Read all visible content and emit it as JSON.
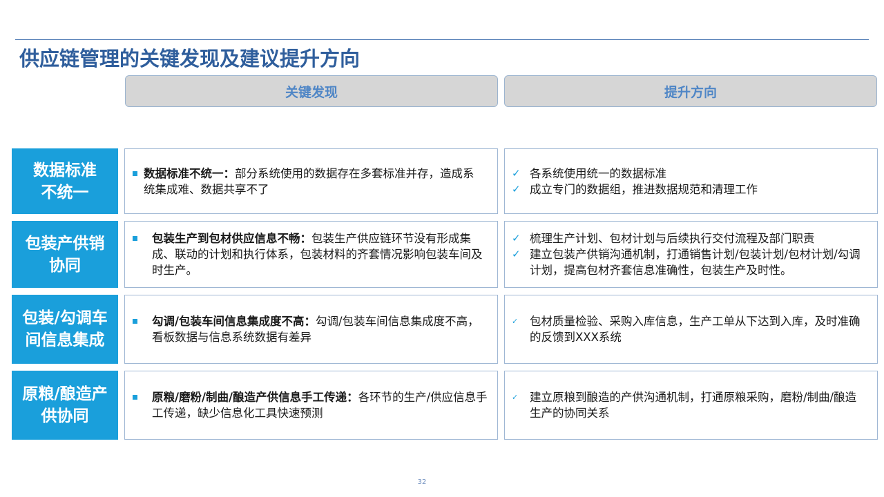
{
  "title": "供应链管理的关键发现及建议提升方向",
  "headers": {
    "findings": "关键发现",
    "direction": "提升方向"
  },
  "rows": [
    {
      "label": "数据标准不统一",
      "finding_bold": "数据标准不统一：",
      "finding_text": "部分系统使用的数据存在多套标准并存，造成系统集成难、数据共享不了",
      "directions": [
        "各系统使用统一的数据标准",
        "成立专门的数据组，推进数据规范和清理工作"
      ]
    },
    {
      "label": "包装产供销协同",
      "finding_bold": "包装生产到包材供应信息不畅：",
      "finding_text": "包装生产供应链环节没有形成集成、联动的计划和执行体系，包装材料的齐套情况影响包装车间及时生产。",
      "directions": [
        "梳理生产计划、包材计划与后续执行交付流程及部门职责",
        "建立包装产供销沟通机制，打通销售计划/包装计划/包材计划/勾调计划，提高包材齐套信息准确性，包装生产及时性。"
      ]
    },
    {
      "label": "包装/勾调车间信息集成",
      "finding_bold": "勾调/包装车间信息集成度不高：",
      "finding_text": "勾调/包装车间信息集成度不高，看板数据与信息系统数据有差异",
      "directions": [
        "包材质量检验、采购入库信息，生产工单从下达到入库，及时准确的反馈到XXX系统"
      ]
    },
    {
      "label": "原粮/酿造产供协同",
      "finding_bold": "原粮/磨粉/制曲/酿造产供信息手工传递：",
      "finding_text": "各环节的生产/供应信息手工传递，缺少信息化工具快速预测",
      "directions": [
        "建立原粮到酿造的产供沟通机制，打通原粮采购，磨粉/制曲/酿造生产的协同关系"
      ]
    }
  ],
  "page_number": "32",
  "icons": {
    "finding_bullet": "square-bullet-icon",
    "direction_bullet": "check-icon"
  },
  "colors": {
    "accent": "#1a9fdb",
    "title": "#2f5e9c",
    "header_bg": "#d6d6d6",
    "header_text": "#4f86c6"
  }
}
